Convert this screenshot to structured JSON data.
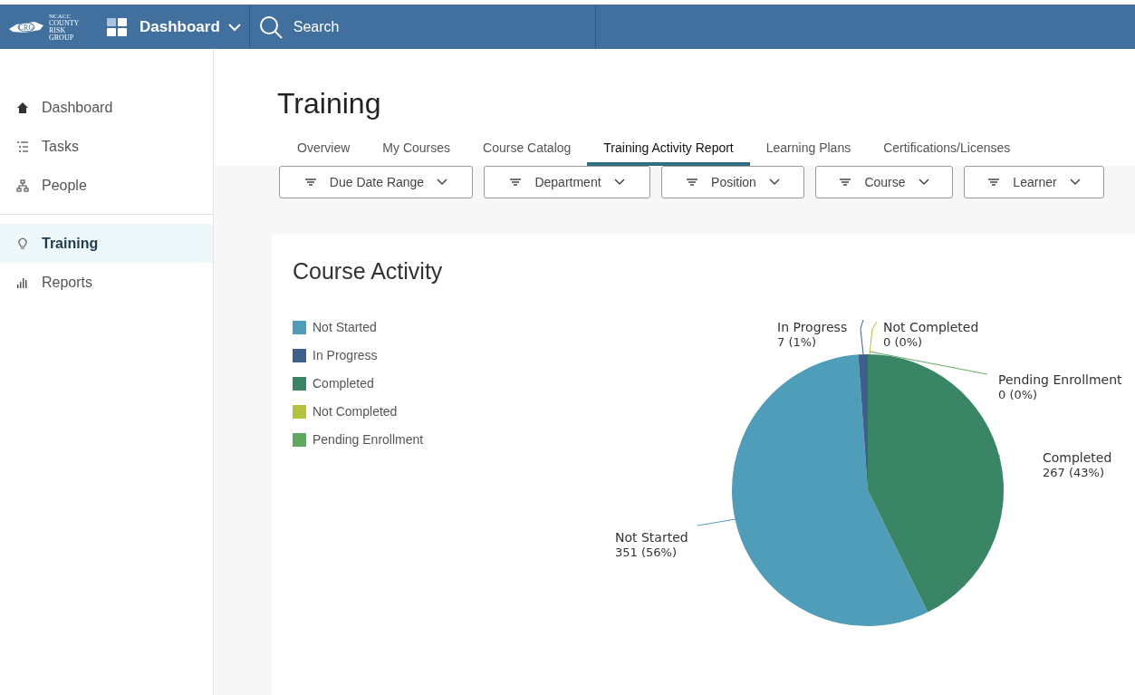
{
  "header": {
    "logo": {
      "badge": "CRG",
      "small": "NCACC",
      "lines": [
        "COUNTY",
        "RISK",
        "GROUP"
      ]
    },
    "menu": "Dashboard",
    "search": {
      "placeholder": "Search"
    }
  },
  "sidebar": {
    "items": [
      {
        "label": "Dashboard",
        "selected": false
      },
      {
        "label": "Tasks",
        "selected": false
      },
      {
        "label": "People",
        "selected": false
      },
      {
        "label": "Training",
        "selected": true
      },
      {
        "label": "Reports",
        "selected": false
      }
    ]
  },
  "page": {
    "title": "Training"
  },
  "tabs": [
    {
      "label": "Overview",
      "selected": false
    },
    {
      "label": "My Courses",
      "selected": false
    },
    {
      "label": "Course Catalog",
      "selected": false
    },
    {
      "label": "Training Activity Report",
      "selected": true
    },
    {
      "label": "Learning Plans",
      "selected": false
    },
    {
      "label": "Certifications/Licenses",
      "selected": false
    }
  ],
  "filters": [
    "Due Date Range",
    "Department",
    "Position",
    "Course",
    "Learner"
  ],
  "card": {
    "title": "Course Activity",
    "chart_data": {
      "type": "pie",
      "categories": [
        "Not Started",
        "In Progress",
        "Completed",
        "Not Completed",
        "Pending Enrollment"
      ],
      "values": [
        351,
        7,
        267,
        0,
        0
      ],
      "colors": [
        "#4f9db8",
        "#3e5f8a",
        "#3a8566",
        "#b5c23f",
        "#5fa860"
      ],
      "data_labels": true,
      "value_labels": [
        "351 (56%)",
        "7 (1%)",
        "267 (43%)",
        "0 (0%)",
        "0 (0%)"
      ]
    }
  }
}
